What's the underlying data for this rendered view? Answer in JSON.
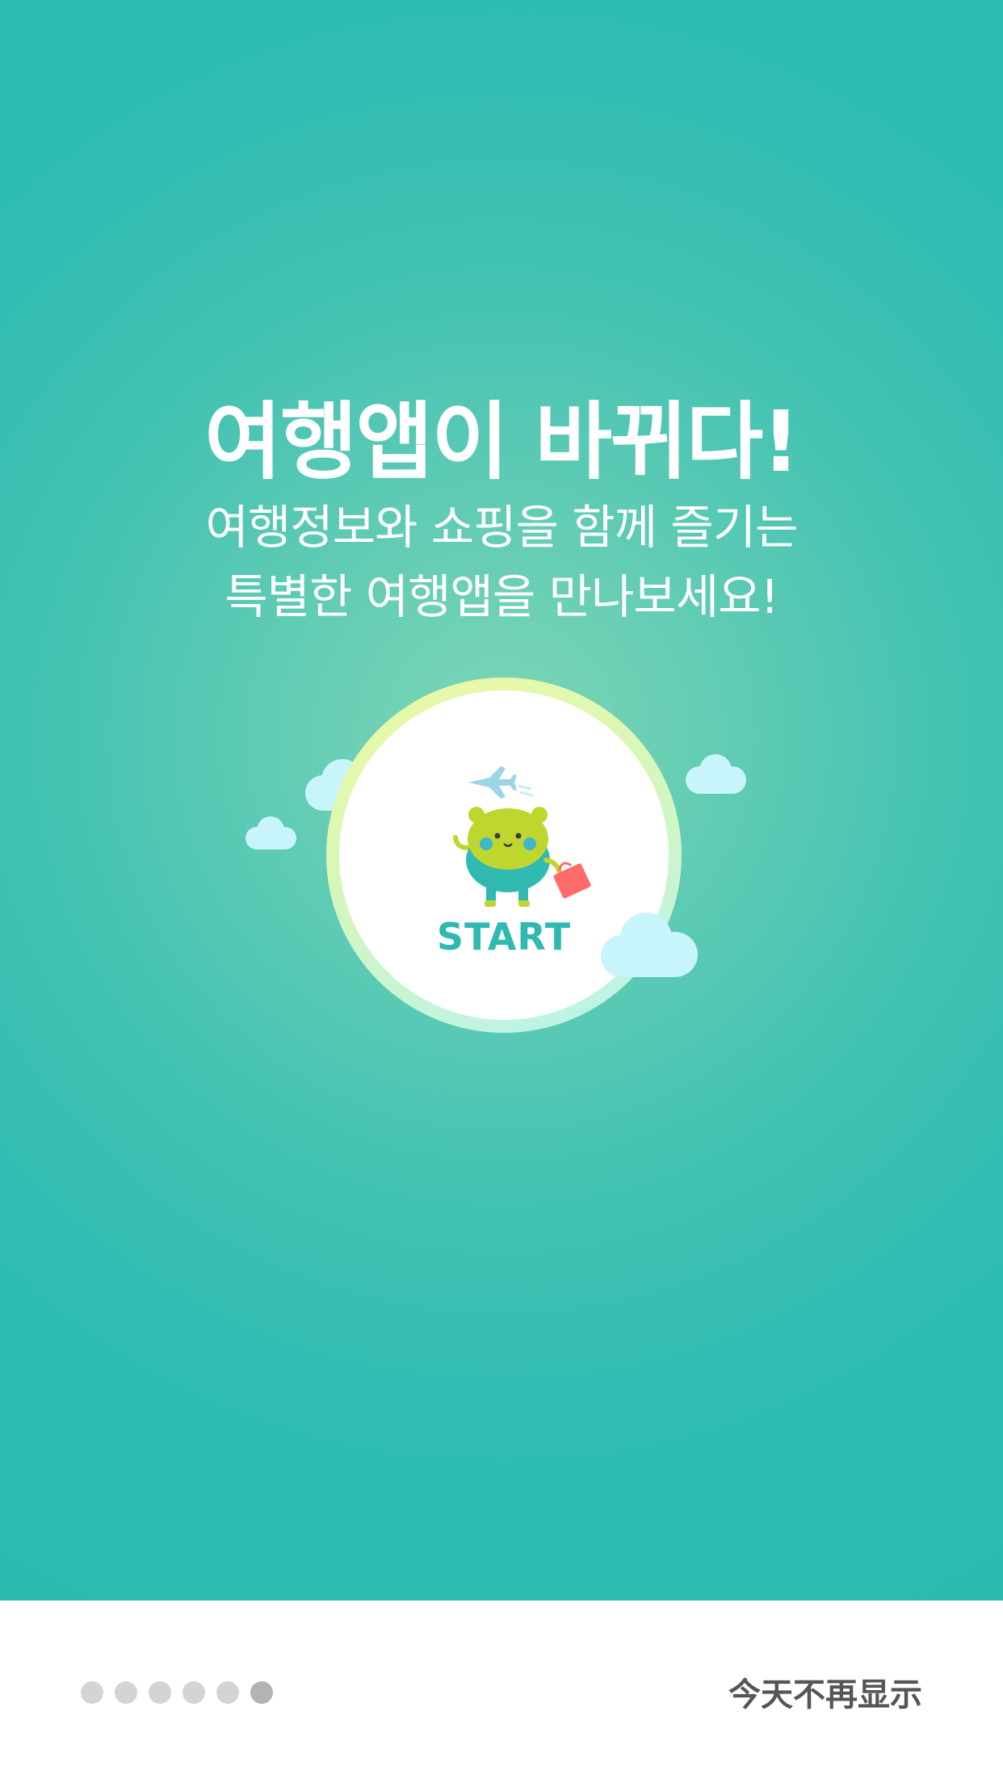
{
  "hero": {
    "title": "여행앱이 바뀌다!",
    "subtitle_line1": "여행정보와 쇼핑을 함께 즐기는",
    "subtitle_line2": "특별한 여행앱을 만나보세요!",
    "start_label": "START",
    "background_color": "#2bb9b2",
    "accent_color": "#2fb9b1"
  },
  "pager": {
    "total_pages": 6,
    "current_page": 6
  },
  "footer": {
    "dismiss_label": "今天不再显示"
  },
  "icons": [
    "cloud-icon",
    "airplane-icon",
    "bear-mascot-icon",
    "shopping-bag-icon"
  ]
}
